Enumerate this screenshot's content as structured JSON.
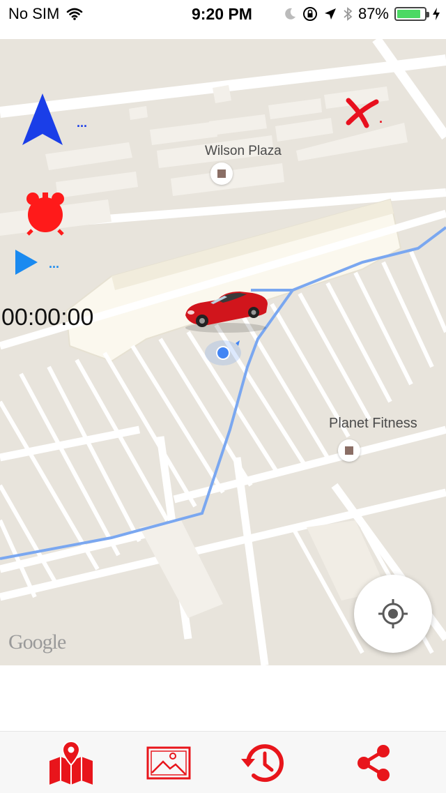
{
  "status_bar": {
    "carrier": "No SIM",
    "time": "9:20 PM",
    "battery_percent": "87%",
    "battery_level": 0.87,
    "icons": [
      "wifi-icon",
      "moon-icon",
      "rotation-lock-icon",
      "location-arrow-icon",
      "bluetooth-icon",
      "charging-bolt-icon"
    ]
  },
  "map": {
    "places": [
      {
        "name": "Wilson Plaza"
      },
      {
        "name": "Planet Fitness"
      }
    ],
    "attribution": "Google",
    "route_color": "#7aa7f0",
    "user_location_color": "#4285f4"
  },
  "overlay": {
    "heading_dots": "...",
    "play_dots": "...",
    "close_dot": ".",
    "timer": "00:00:00",
    "colors": {
      "heading": "#1a3ee8",
      "alarm": "#ff1a1a",
      "close": "#e8101e"
    }
  },
  "tab_bar": {
    "accent": "#e8151b",
    "items": [
      {
        "icon": "map-pin-icon"
      },
      {
        "icon": "image-icon"
      },
      {
        "icon": "history-icon"
      },
      {
        "icon": "share-icon"
      }
    ]
  }
}
